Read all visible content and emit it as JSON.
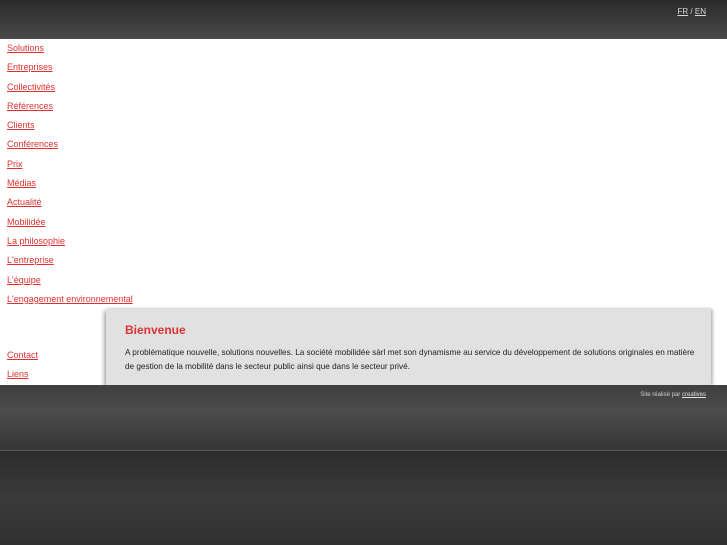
{
  "lang": {
    "fr": "FR",
    "separator": "/",
    "en": "EN"
  },
  "nav": [
    "Solutions",
    "Entreprises",
    "Collectivités",
    "Références",
    "Clients",
    "Conférences",
    "Prix",
    "Médias",
    "Actualité",
    "Mobilidée",
    "La philosophie",
    "L'entreprise",
    "L'équipe",
    "L'engagement environnemental"
  ],
  "nav_secondary": [
    "Contact",
    "Liens"
  ],
  "content": {
    "title": "Bienvenue",
    "text": "A problématique nouvelle, solutions nouvelles. La société mobilidée sàrl met son dynamisme au service du développement de solutions originales en matière de gestion de la mobilité dans le secteur public ainsi que dans le secteur privé."
  },
  "footer": {
    "credit_prefix": "Site réalisé par",
    "credit_link": "creatives"
  },
  "colors": {
    "accent": "#e03030",
    "title": "#dd3333",
    "panel": "#e1e1e1"
  }
}
